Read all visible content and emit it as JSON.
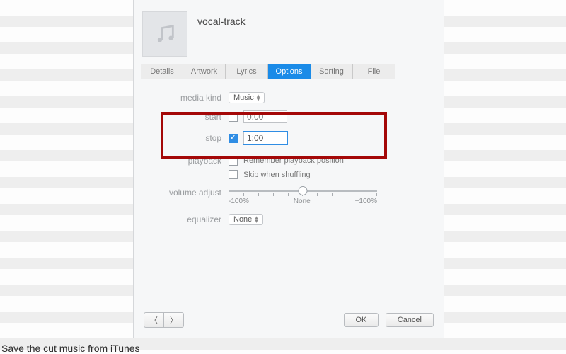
{
  "track": {
    "title": "vocal-track"
  },
  "tabs": [
    {
      "label": "Details",
      "active": false
    },
    {
      "label": "Artwork",
      "active": false
    },
    {
      "label": "Lyrics",
      "active": false
    },
    {
      "label": "Options",
      "active": true
    },
    {
      "label": "Sorting",
      "active": false
    },
    {
      "label": "File",
      "active": false
    }
  ],
  "options": {
    "media_kind_label": "media kind",
    "media_kind_value": "Music",
    "start_label": "start",
    "start_checked": false,
    "start_value": "0:00",
    "stop_label": "stop",
    "stop_checked": true,
    "stop_value": "1:00",
    "playback_label": "playback",
    "remember_label": "Remember playback position",
    "remember_checked": false,
    "skip_label": "Skip when shuffling",
    "skip_checked": false,
    "volume_label": "volume adjust",
    "volume_min": "-100%",
    "volume_mid": "None",
    "volume_max": "+100%",
    "equalizer_label": "equalizer",
    "equalizer_value": "None"
  },
  "footer": {
    "ok": "OK",
    "cancel": "Cancel"
  },
  "caption": "Save the cut music from iTunes"
}
